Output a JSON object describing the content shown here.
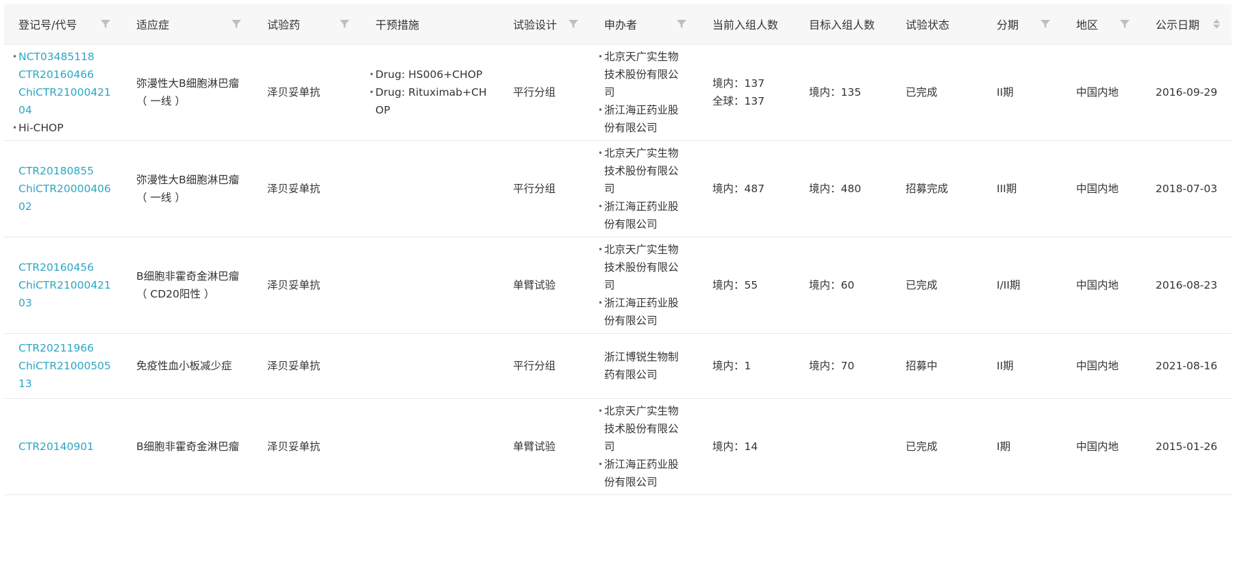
{
  "columns": [
    {
      "label": "登记号/代号",
      "filter": true
    },
    {
      "label": "适应症",
      "filter": true
    },
    {
      "label": "试验药",
      "filter": true
    },
    {
      "label": "干预措施",
      "filter": false
    },
    {
      "label": "试验设计",
      "filter": true
    },
    {
      "label": "申办者",
      "filter": true
    },
    {
      "label": "当前入组人数",
      "filter": false
    },
    {
      "label": "目标入组人数",
      "filter": false
    },
    {
      "label": "试验状态",
      "filter": false
    },
    {
      "label": "分期",
      "filter": true
    },
    {
      "label": "地区",
      "filter": true
    },
    {
      "label": "公示日期",
      "filter": false,
      "sort": true
    }
  ],
  "rows": [
    {
      "ids": [
        "NCT03485118",
        "CTR20160466",
        "ChiCTR2100042104"
      ],
      "codes": [
        "Hi-CHOP"
      ],
      "ids_bulleted": true,
      "indication": "弥漫性大B细胞淋巴瘤（ 一线 ）",
      "drug": "泽贝妥单抗",
      "interventions": [
        "Drug: HS006+CHOP",
        "Drug: Rituximab+CHOP"
      ],
      "design": "平行分组",
      "sponsors": [
        "北京天广实生物技术股份有限公司",
        "浙江海正药业股份有限公司"
      ],
      "sponsors_bulleted": true,
      "current_enroll": [
        "境内：137",
        "全球：137"
      ],
      "target_enroll": [
        "境内：135"
      ],
      "status": "已完成",
      "phase": "II期",
      "region": "中国内地",
      "date": "2016-09-29"
    },
    {
      "ids": [
        "CTR20180855",
        "ChiCTR2000040602"
      ],
      "codes": [],
      "ids_bulleted": false,
      "indication": "弥漫性大B细胞淋巴瘤（ 一线 ）",
      "drug": "泽贝妥单抗",
      "interventions": [],
      "design": "平行分组",
      "sponsors": [
        "北京天广实生物技术股份有限公司",
        "浙江海正药业股份有限公司"
      ],
      "sponsors_bulleted": true,
      "current_enroll": [
        "境内：487"
      ],
      "target_enroll": [
        "境内：480"
      ],
      "status": "招募完成",
      "phase": "III期",
      "region": "中国内地",
      "date": "2018-07-03"
    },
    {
      "ids": [
        "CTR20160456",
        "ChiCTR2100042103"
      ],
      "codes": [],
      "ids_bulleted": false,
      "indication": "B细胞非霍奇金淋巴瘤（ CD20阳性 ）",
      "drug": "泽贝妥单抗",
      "interventions": [],
      "design": "单臂试验",
      "sponsors": [
        "北京天广实生物技术股份有限公司",
        "浙江海正药业股份有限公司"
      ],
      "sponsors_bulleted": true,
      "current_enroll": [
        "境内：55"
      ],
      "target_enroll": [
        "境内：60"
      ],
      "status": "已完成",
      "phase": "I/II期",
      "region": "中国内地",
      "date": "2016-08-23"
    },
    {
      "ids": [
        "CTR20211966",
        "ChiCTR2100050513"
      ],
      "codes": [],
      "ids_bulleted": false,
      "indication": "免疫性血小板减少症",
      "drug": "泽贝妥单抗",
      "interventions": [],
      "design": "平行分组",
      "sponsors": [
        "浙江博锐生物制药有限公司"
      ],
      "sponsors_bulleted": false,
      "current_enroll": [
        "境内：1"
      ],
      "target_enroll": [
        "境内：70"
      ],
      "status": "招募中",
      "phase": "II期",
      "region": "中国内地",
      "date": "2021-08-16"
    },
    {
      "ids": [
        "CTR20140901"
      ],
      "codes": [],
      "ids_bulleted": false,
      "indication": "B细胞非霍奇金淋巴瘤",
      "drug": "泽贝妥单抗",
      "interventions": [],
      "design": "单臂试验",
      "sponsors": [
        "北京天广实生物技术股份有限公司",
        "浙江海正药业股份有限公司"
      ],
      "sponsors_bulleted": true,
      "current_enroll": [
        "境内：14"
      ],
      "target_enroll": [],
      "status": "已完成",
      "phase": "I期",
      "region": "中国内地",
      "date": "2015-01-26"
    }
  ],
  "colors": {
    "link": "#2aa6c5",
    "header_bg": "#f7f7f7",
    "border": "#e8e8e8",
    "icon": "#bfbfbf",
    "text": "#333333"
  }
}
